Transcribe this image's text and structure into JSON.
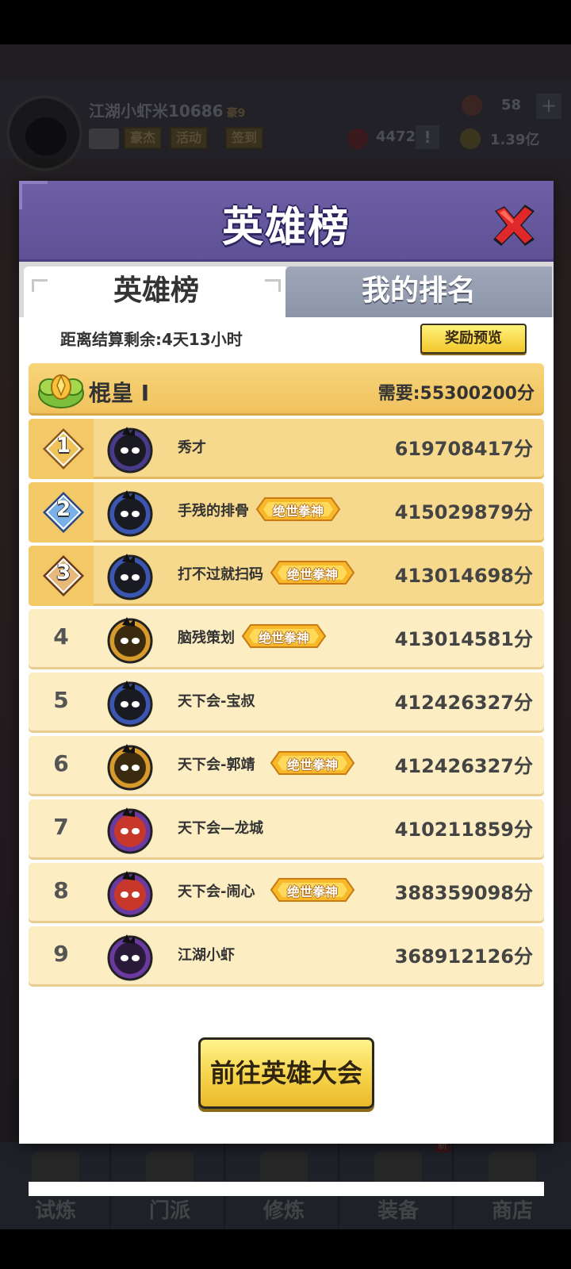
{
  "background": {
    "player": {
      "name": "江湖小虾米10686",
      "vip": "豪9",
      "buttons": [
        "豪杰",
        "活动",
        "签到"
      ]
    },
    "resources": {
      "gems": "58",
      "tokens": "4472",
      "coins": "1.39亿",
      "plus_label": "+",
      "alert_label": "!"
    },
    "nav": [
      {
        "label": "试炼",
        "icon": "ninja-icon"
      },
      {
        "label": "门派",
        "icon": "temple-icon"
      },
      {
        "label": "修炼",
        "icon": "book-icon"
      },
      {
        "label": "装备",
        "icon": "sword-icon"
      },
      {
        "label": "商店",
        "icon": "shop-icon"
      }
    ],
    "new_badge": "新"
  },
  "dialog": {
    "title": "英雄榜",
    "close_icon": "close-x-icon",
    "tabs": [
      {
        "label": "英雄榜",
        "active": true
      },
      {
        "label": "我的排名",
        "active": false
      }
    ],
    "countdown": "距离结算剩余:4天13小时",
    "reward_button": "奖励预览",
    "tier": {
      "name": "棍皇 I",
      "requirement": "需要:55300200分"
    },
    "rows": [
      {
        "rank": "1",
        "name": "秀才",
        "badge": "",
        "score": "619708417分",
        "avatar": "black-ninja"
      },
      {
        "rank": "2",
        "name": "手残的排骨",
        "badge": "绝世拳神",
        "score": "415029879分",
        "avatar": "blue-ninja"
      },
      {
        "rank": "3",
        "name": "打不过就扫码",
        "badge": "绝世拳神",
        "score": "413014698分",
        "avatar": "blue-ninja"
      },
      {
        "rank": "4",
        "name": "脑残策划",
        "badge": "绝世拳神",
        "score": "413014581分",
        "avatar": "gold-ninja"
      },
      {
        "rank": "5",
        "name": "天下会-宝叔",
        "badge": "",
        "score": "412426327分",
        "avatar": "blue-ninja"
      },
      {
        "rank": "6",
        "name": "天下会-郭靖",
        "badge": "绝世拳神",
        "score": "412426327分",
        "avatar": "gold-ninja"
      },
      {
        "rank": "7",
        "name": "天下会—龙城",
        "badge": "",
        "score": "410211859分",
        "avatar": "red-fox"
      },
      {
        "rank": "8",
        "name": "天下会-闹心",
        "badge": "绝世拳神",
        "score": "388359098分",
        "avatar": "red-fox"
      },
      {
        "rank": "9",
        "name": "江湖小虾",
        "badge": "",
        "score": "368912126分",
        "avatar": "purple-ninja"
      }
    ],
    "go_button": "前往英雄大会"
  },
  "colors": {
    "header": "#6e5fa6",
    "row_top": "#f7d98d",
    "row_normal": "#fcedc3",
    "button": "#f6d34a"
  }
}
